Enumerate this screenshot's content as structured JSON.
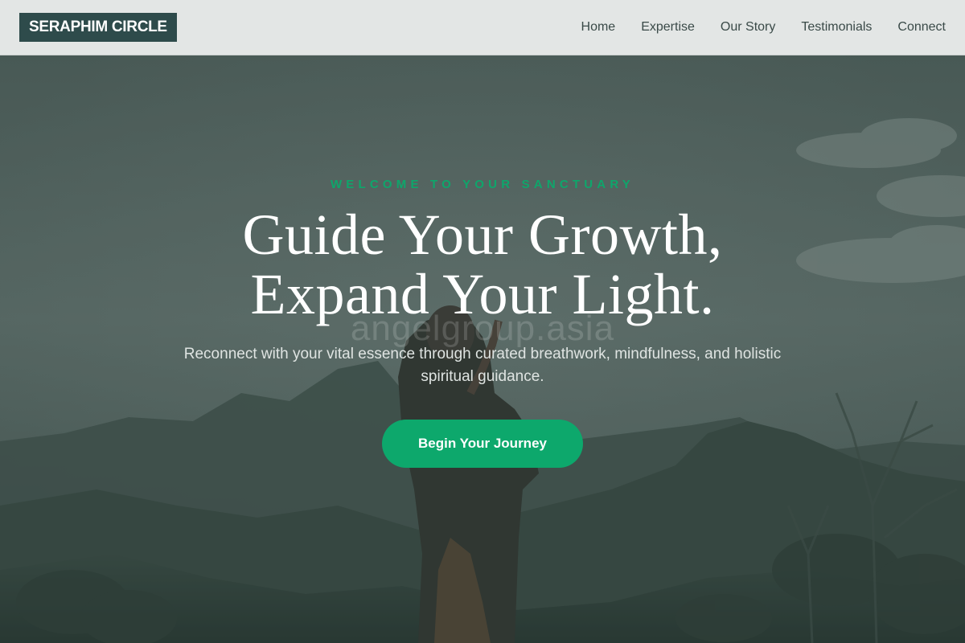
{
  "header": {
    "logo": "SERAPHIM CIRCLE",
    "nav": [
      {
        "label": "Home"
      },
      {
        "label": "Expertise"
      },
      {
        "label": "Our Story"
      },
      {
        "label": "Testimonials"
      },
      {
        "label": "Connect"
      }
    ]
  },
  "hero": {
    "eyebrow": "WELCOME TO YOUR SANCTUARY",
    "headline_line1": "Guide Your Growth,",
    "headline_line2": "Expand Your Light.",
    "watermark": "angelgroup.asia",
    "subtitle_line1": "Reconnect with your vital essence through curated breathwork, mindfulness, and holistic",
    "subtitle_line2": "spiritual guidance.",
    "cta_label": "Begin Your Journey"
  },
  "colors": {
    "header_bg": "#e3e6e5",
    "logo_bg": "#2e4b4b",
    "accent": "#0da86c",
    "hero_overlay": "#4a5a57"
  }
}
